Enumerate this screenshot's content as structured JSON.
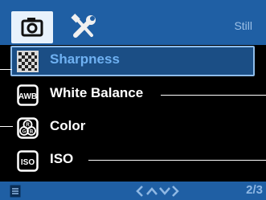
{
  "header": {
    "tabs": [
      {
        "name": "camera-tab",
        "icon": "camera-icon",
        "active": true
      },
      {
        "name": "settings-tab",
        "icon": "tools-icon",
        "active": false
      }
    ],
    "mode_label": "Still"
  },
  "menu": {
    "items": [
      {
        "label": "Sharpness",
        "icon": "sharpness-icon",
        "selected": true
      },
      {
        "label": "White Balance",
        "icon": "awb-icon",
        "icon_text": "AWB",
        "selected": false
      },
      {
        "label": "Color",
        "icon": "color-rgb-icon",
        "icon_text": "RGB",
        "selected": false
      },
      {
        "label": "ISO",
        "icon": "iso-icon",
        "icon_text": "ISO",
        "selected": false
      }
    ]
  },
  "footer": {
    "doc_icon": "document-icon",
    "nav_icon": "nav-arrows-icon",
    "page": "2/3"
  },
  "colors": {
    "bar_blue": "#1f5fa4",
    "selected_bg": "#1b4e85",
    "selected_text": "#6fb1f2",
    "text": "#ffffff"
  }
}
